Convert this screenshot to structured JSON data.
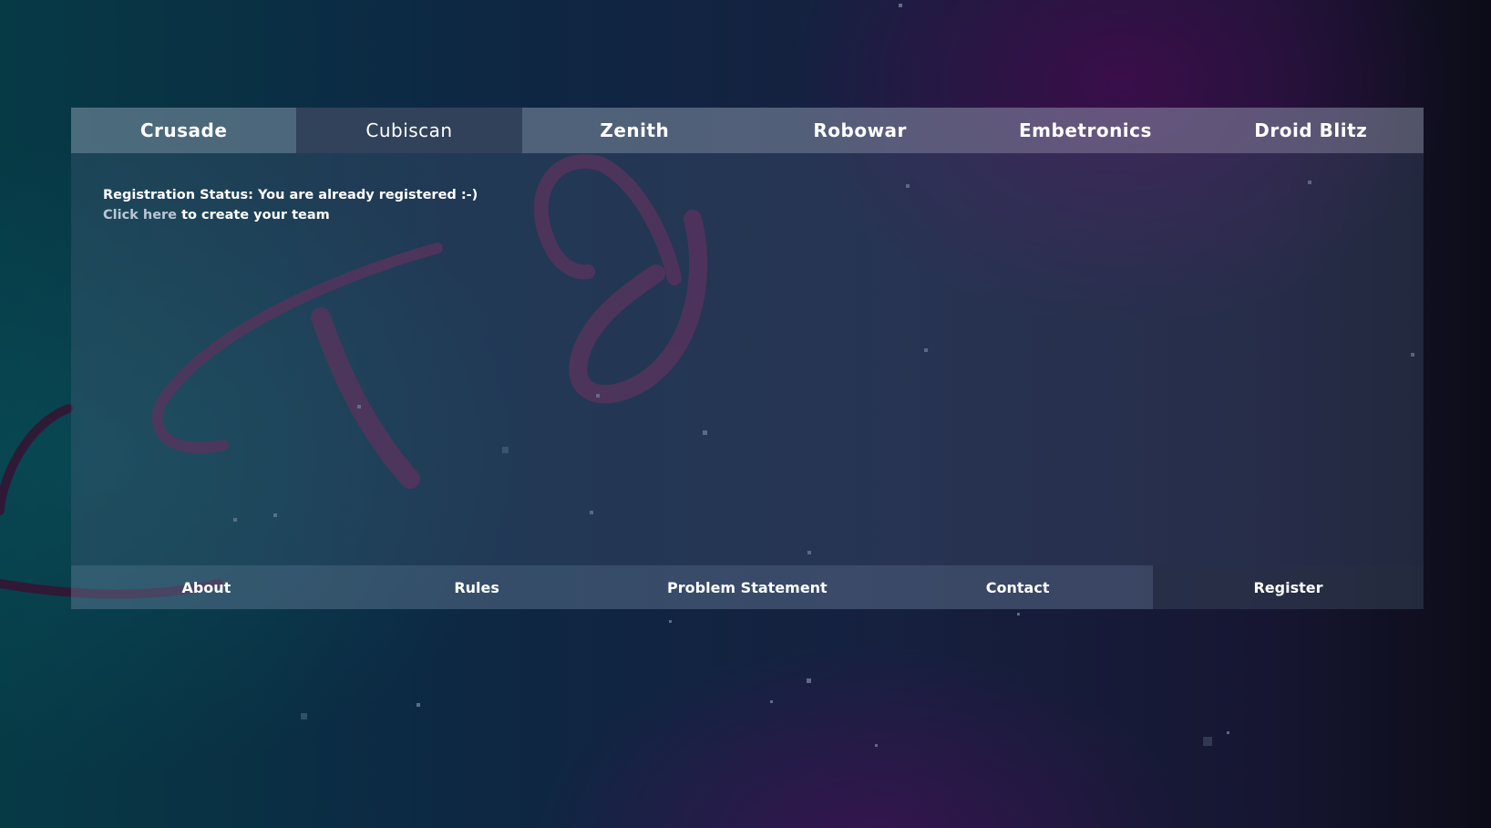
{
  "event_tabs": [
    {
      "label": "Crusade",
      "active": false
    },
    {
      "label": "Cubiscan",
      "active": true
    },
    {
      "label": "Zenith",
      "active": false
    },
    {
      "label": "Robowar",
      "active": false
    },
    {
      "label": "Embetronics",
      "active": false
    },
    {
      "label": "Droid Blitz",
      "active": false
    }
  ],
  "panel": {
    "status_text": "Registration Status: You are already registered :-)",
    "cta_link": "Click here",
    "cta_suffix": " to create your team"
  },
  "footer": {
    "items": [
      "About",
      "Rules",
      "Problem Statement",
      "Contact"
    ],
    "register_label": "Register"
  },
  "colors": {
    "link_color": "#b9c6d6",
    "active_tab_bg": "#28374f",
    "tab_bar_bg": "#aab4c8"
  }
}
